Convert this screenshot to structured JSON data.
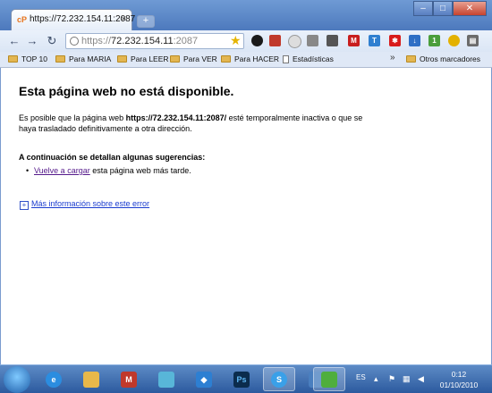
{
  "browser": {
    "tab_title": "https://72.232.154.11:2087",
    "tab_favicon_text": "cP",
    "new_tab_label": "+",
    "window_buttons": {
      "minimize": "–",
      "maximize": "□",
      "close": "✕"
    },
    "address": {
      "scheme": "https://",
      "host": "72.232.154.11",
      "port": ":2087"
    }
  },
  "bookmarks": {
    "items": [
      {
        "label": "TOP 10",
        "icon": "folder-icon"
      },
      {
        "label": "Para MARIA",
        "icon": "folder-icon"
      },
      {
        "label": "Para LEER",
        "icon": "folder-icon"
      },
      {
        "label": "Para VER",
        "icon": "folder-icon"
      },
      {
        "label": "Para HACER",
        "icon": "folder-icon"
      },
      {
        "label": "Estadísticas",
        "icon": "page-icon"
      }
    ],
    "overflow": "»",
    "other": "Otros marcadores"
  },
  "error_page": {
    "title": "Esta página web no está disponible.",
    "body_pre": "Es posible que la página web ",
    "body_url": "https://72.232.154.11:2087/",
    "body_post": " esté temporalmente inactiva o que se haya trasladado definitivamente a otra dirección.",
    "suggestions_heading": "A continuación se detallan algunas sugerencias:",
    "suggestion_link": "Vuelve a cargar",
    "suggestion_rest": " esta página web más tarde.",
    "more_info_link": "Más información sobre este error"
  },
  "taskbar": {
    "language": "ES",
    "time": "0:12",
    "date": "01/10/2010"
  },
  "colors": {
    "link_visited": "#551a8b",
    "link": "#1a3ccf",
    "taskbar": "#2c5a9e"
  }
}
